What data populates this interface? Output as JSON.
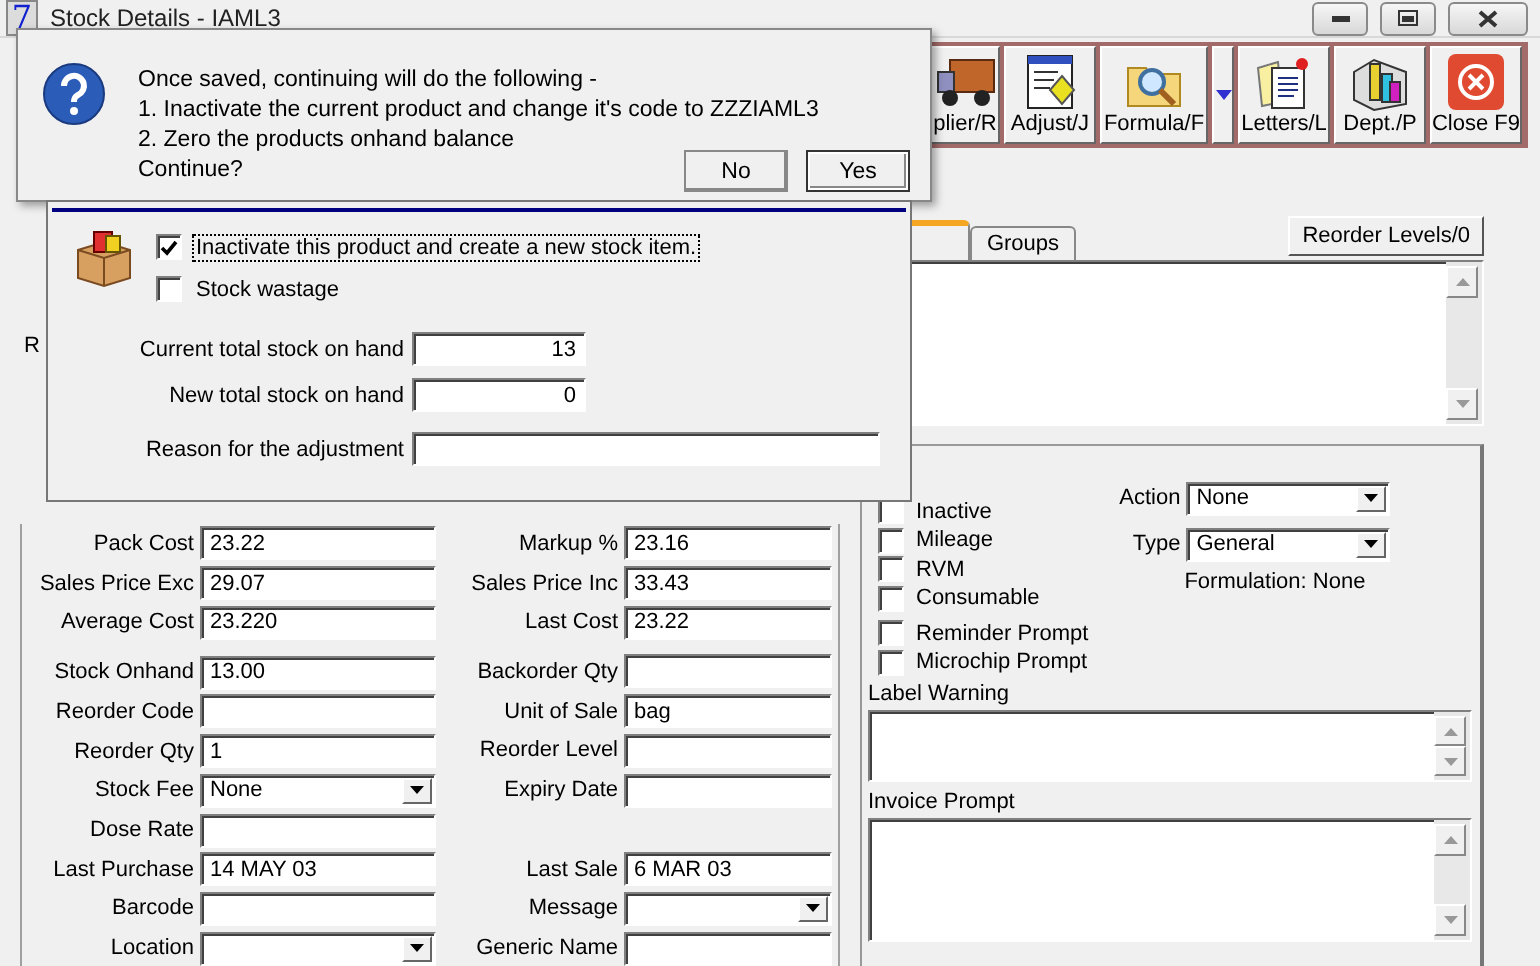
{
  "window": {
    "icon_text": "7",
    "title": "Stock Details - IAML3"
  },
  "toolbar": [
    {
      "label": "plier/R"
    },
    {
      "label": "Adjust/J"
    },
    {
      "label": "Formula/F"
    },
    {
      "label": "Letters/L"
    },
    {
      "label": "Dept./P"
    },
    {
      "label": "Close F9"
    }
  ],
  "side_label": "R",
  "left_fields": [
    {
      "label": "Pack Cost",
      "value": "23.22",
      "kind": "text"
    },
    {
      "label": "Sales Price Exc",
      "value": "29.07",
      "kind": "text"
    },
    {
      "label": "Average Cost",
      "value": "23.220",
      "kind": "text"
    },
    {
      "label": "Stock Onhand",
      "value": "13.00",
      "kind": "text"
    },
    {
      "label": "Reorder Code",
      "kind": "text"
    },
    {
      "label": "Reorder Qty",
      "value": "1",
      "kind": "text"
    },
    {
      "label": "Stock Fee",
      "value": "None",
      "kind": "select"
    },
    {
      "label": "Dose Rate",
      "kind": "text"
    },
    {
      "label": "Last Purchase",
      "value": "14 MAY 03",
      "kind": "text"
    },
    {
      "label": "Barcode",
      "kind": "text"
    },
    {
      "label": "Location",
      "kind": "select"
    }
  ],
  "right_fields": [
    {
      "label": "Markup %",
      "value": "23.16",
      "kind": "text"
    },
    {
      "label": "Sales Price Inc",
      "value": "33.43",
      "kind": "text"
    },
    {
      "label": "Last Cost",
      "value": "23.22",
      "kind": "text"
    },
    {
      "label": "Backorder Qty",
      "kind": "text"
    },
    {
      "label": "Unit of Sale",
      "value": "bag",
      "kind": "text"
    },
    {
      "label": "Reorder Level",
      "kind": "text"
    },
    {
      "label": "Expiry Date",
      "kind": "text"
    },
    {
      "label": "Last Sale",
      "value": "6 MAR 03",
      "kind": "text"
    },
    {
      "label": "Message",
      "kind": "select"
    },
    {
      "label": "Generic Name",
      "kind": "text"
    }
  ],
  "tabs": [
    {
      "selected": true
    },
    {
      "label": "Groups",
      "selected": false
    }
  ],
  "reorder_button": "Reorder Levels/0",
  "flags": [
    {
      "label": "Inactive",
      "checked": false
    },
    {
      "label": "Mileage",
      "checked": false
    },
    {
      "label": "RVM",
      "checked": false
    },
    {
      "label": "Consumable",
      "checked": false
    },
    {
      "label": "Reminder Prompt",
      "checked": false
    },
    {
      "label": "Microchip Prompt",
      "checked": false
    }
  ],
  "selects": [
    {
      "label": "Action",
      "value": "None"
    },
    {
      "label": "Type",
      "value": "General"
    }
  ],
  "formulation": "Formulation: None",
  "memos": [
    {
      "label": "Label Warning"
    },
    {
      "label": "Invoice Prompt"
    }
  ],
  "message_box": {
    "lines": [
      "Once saved, continuing will do the following -",
      "1. Inactivate the current product and change it's code to ZZZIAML3",
      "2. Zero the products onhand balance",
      "Continue?"
    ],
    "buttons": [
      {
        "label": "No",
        "default": false
      },
      {
        "label": "Yes",
        "default": true
      }
    ]
  },
  "adjustment": {
    "options": [
      {
        "label": "Inactivate this product and create a new stock item.",
        "checked": true,
        "focused": true
      },
      {
        "label": "Stock wastage",
        "checked": false,
        "focused": false
      }
    ],
    "fields": [
      {
        "label": "Current total stock on hand",
        "value": "13"
      },
      {
        "label": "New total stock on hand",
        "value": "0"
      },
      {
        "label": "Reason for the adjustment"
      }
    ]
  }
}
